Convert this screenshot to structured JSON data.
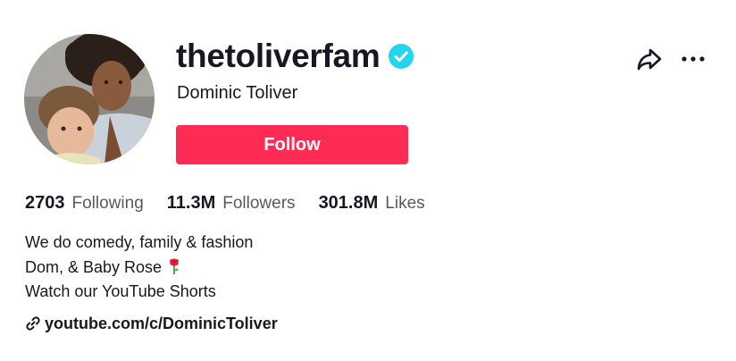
{
  "profile": {
    "username": "thetoliverfam",
    "display_name": "Dominic Toliver",
    "verified": true,
    "avatar": "avatar-photo"
  },
  "actions": {
    "follow_label": "Follow",
    "share_icon": "share-icon",
    "more_icon": "more-icon"
  },
  "stats": [
    {
      "count": "2703",
      "label": "Following"
    },
    {
      "count": "11.3M",
      "label": "Followers"
    },
    {
      "count": "301.8M",
      "label": "Likes"
    }
  ],
  "bio": {
    "lines": [
      "We do comedy, family & fashion",
      "Dom, & Baby Rose",
      "Watch our YouTube Shorts"
    ],
    "emoji": "rose-icon"
  },
  "link": {
    "text": "youtube.com/c/DominicToliver",
    "icon": "link-icon"
  },
  "colors": {
    "brand_red": "#fe2c55",
    "verified_blue": "#20d5ec",
    "text": "#161823",
    "muted_text": "rgba(22,24,35,0.72)"
  }
}
